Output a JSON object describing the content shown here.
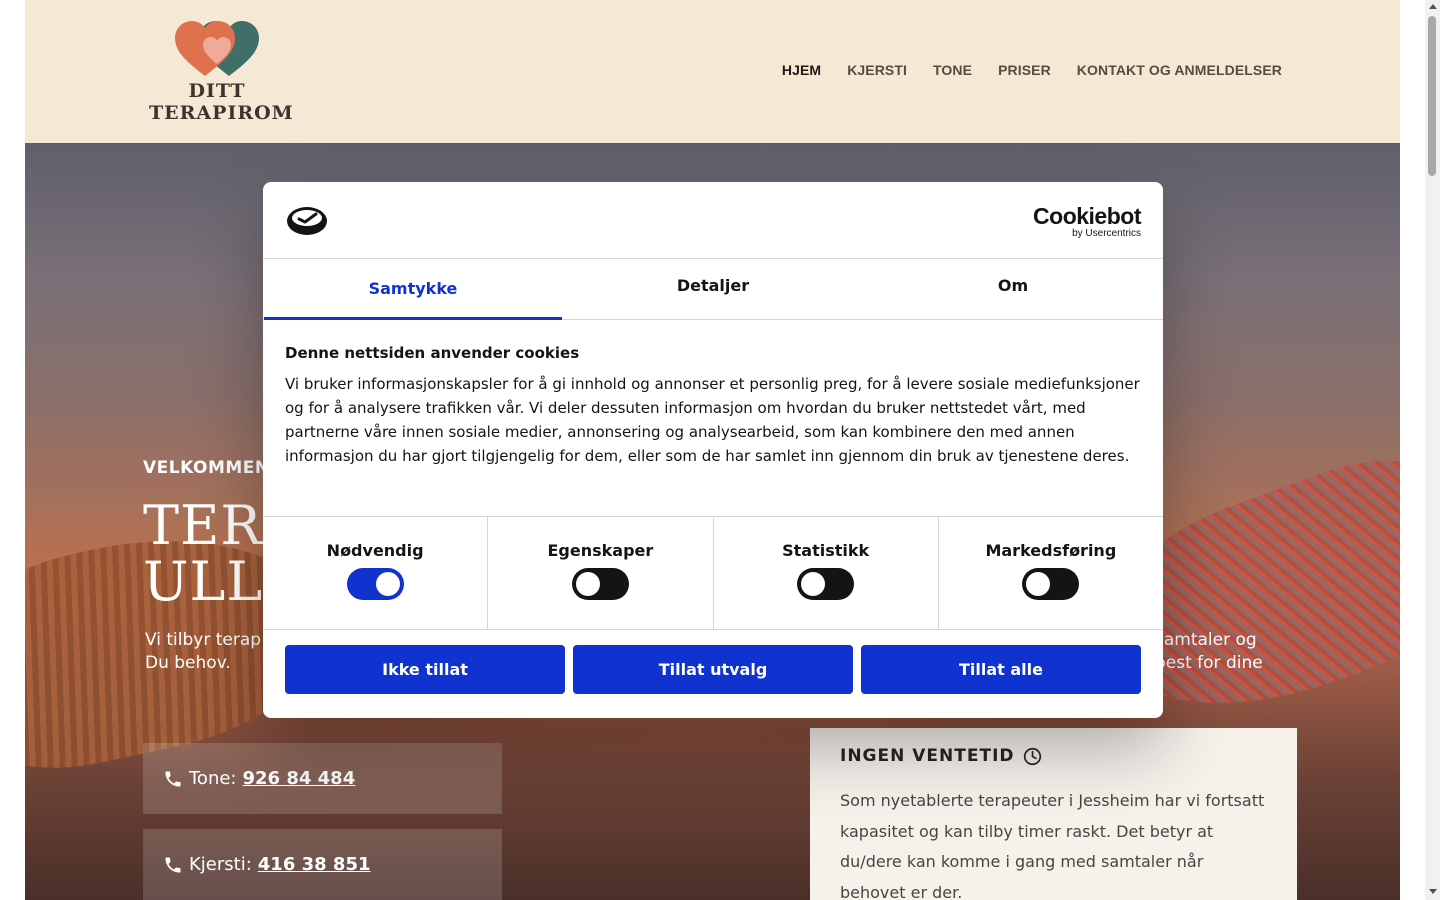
{
  "header": {
    "logo": {
      "line1": "DITT",
      "line2": "TERAPIROM"
    },
    "nav": [
      {
        "label": "HJEM",
        "active": true
      },
      {
        "label": "KJERSTI",
        "active": false
      },
      {
        "label": "TONE",
        "active": false
      },
      {
        "label": "PRISER",
        "active": false
      },
      {
        "label": "KONTAKT OG ANMELDELSER",
        "active": false
      }
    ]
  },
  "hero": {
    "welcome": "VELKOMMEN",
    "title_line1": "TERA",
    "title_line2": "ULLE",
    "text_left": "Vi tilbyr terap utvikling. Du behov.",
    "text_right": "samtaler og best for dine",
    "phones": [
      {
        "name": "Tone:",
        "number": "926 84 484"
      },
      {
        "name": "Kjersti:",
        "number": "416 38 851"
      }
    ],
    "info_card": {
      "title": "INGEN VENTETID",
      "icon": "clock-icon",
      "text": "Som nyetablerte terapeuter i Jessheim har vi fortsatt kapasitet og kan tilby timer raskt. Det betyr at du/dere kan komme i gang med samtaler når behovet er der."
    }
  },
  "cookie_dialog": {
    "brand_name": "Cookiebot",
    "brand_sub": "by Usercentrics",
    "tabs": [
      {
        "label": "Samtykke",
        "active": true
      },
      {
        "label": "Detaljer",
        "active": false
      },
      {
        "label": "Om",
        "active": false
      }
    ],
    "heading": "Denne nettsiden anvender cookies",
    "text": "Vi bruker informasjonskapsler for å gi innhold og annonser et personlig preg, for å levere sosiale mediefunksjoner og for å analysere trafikken vår. Vi deler dessuten informasjon om hvordan du bruker nettstedet vårt, med partnerne våre innen sosiale medier, annonsering og analysearbeid, som kan kombinere den med annen informasjon du har gjort tilgjengelig for dem, eller som de har samlet inn gjennom din bruk av tjenestene deres.",
    "toggles": [
      {
        "label": "Nødvendig",
        "on": true
      },
      {
        "label": "Egenskaper",
        "on": false
      },
      {
        "label": "Statistikk",
        "on": false
      },
      {
        "label": "Markedsføring",
        "on": false
      }
    ],
    "buttons": {
      "deny": "Ikke tillat",
      "selection": "Tillat utvalg",
      "all": "Tillat alle"
    },
    "accent_color": "#1032cf"
  }
}
